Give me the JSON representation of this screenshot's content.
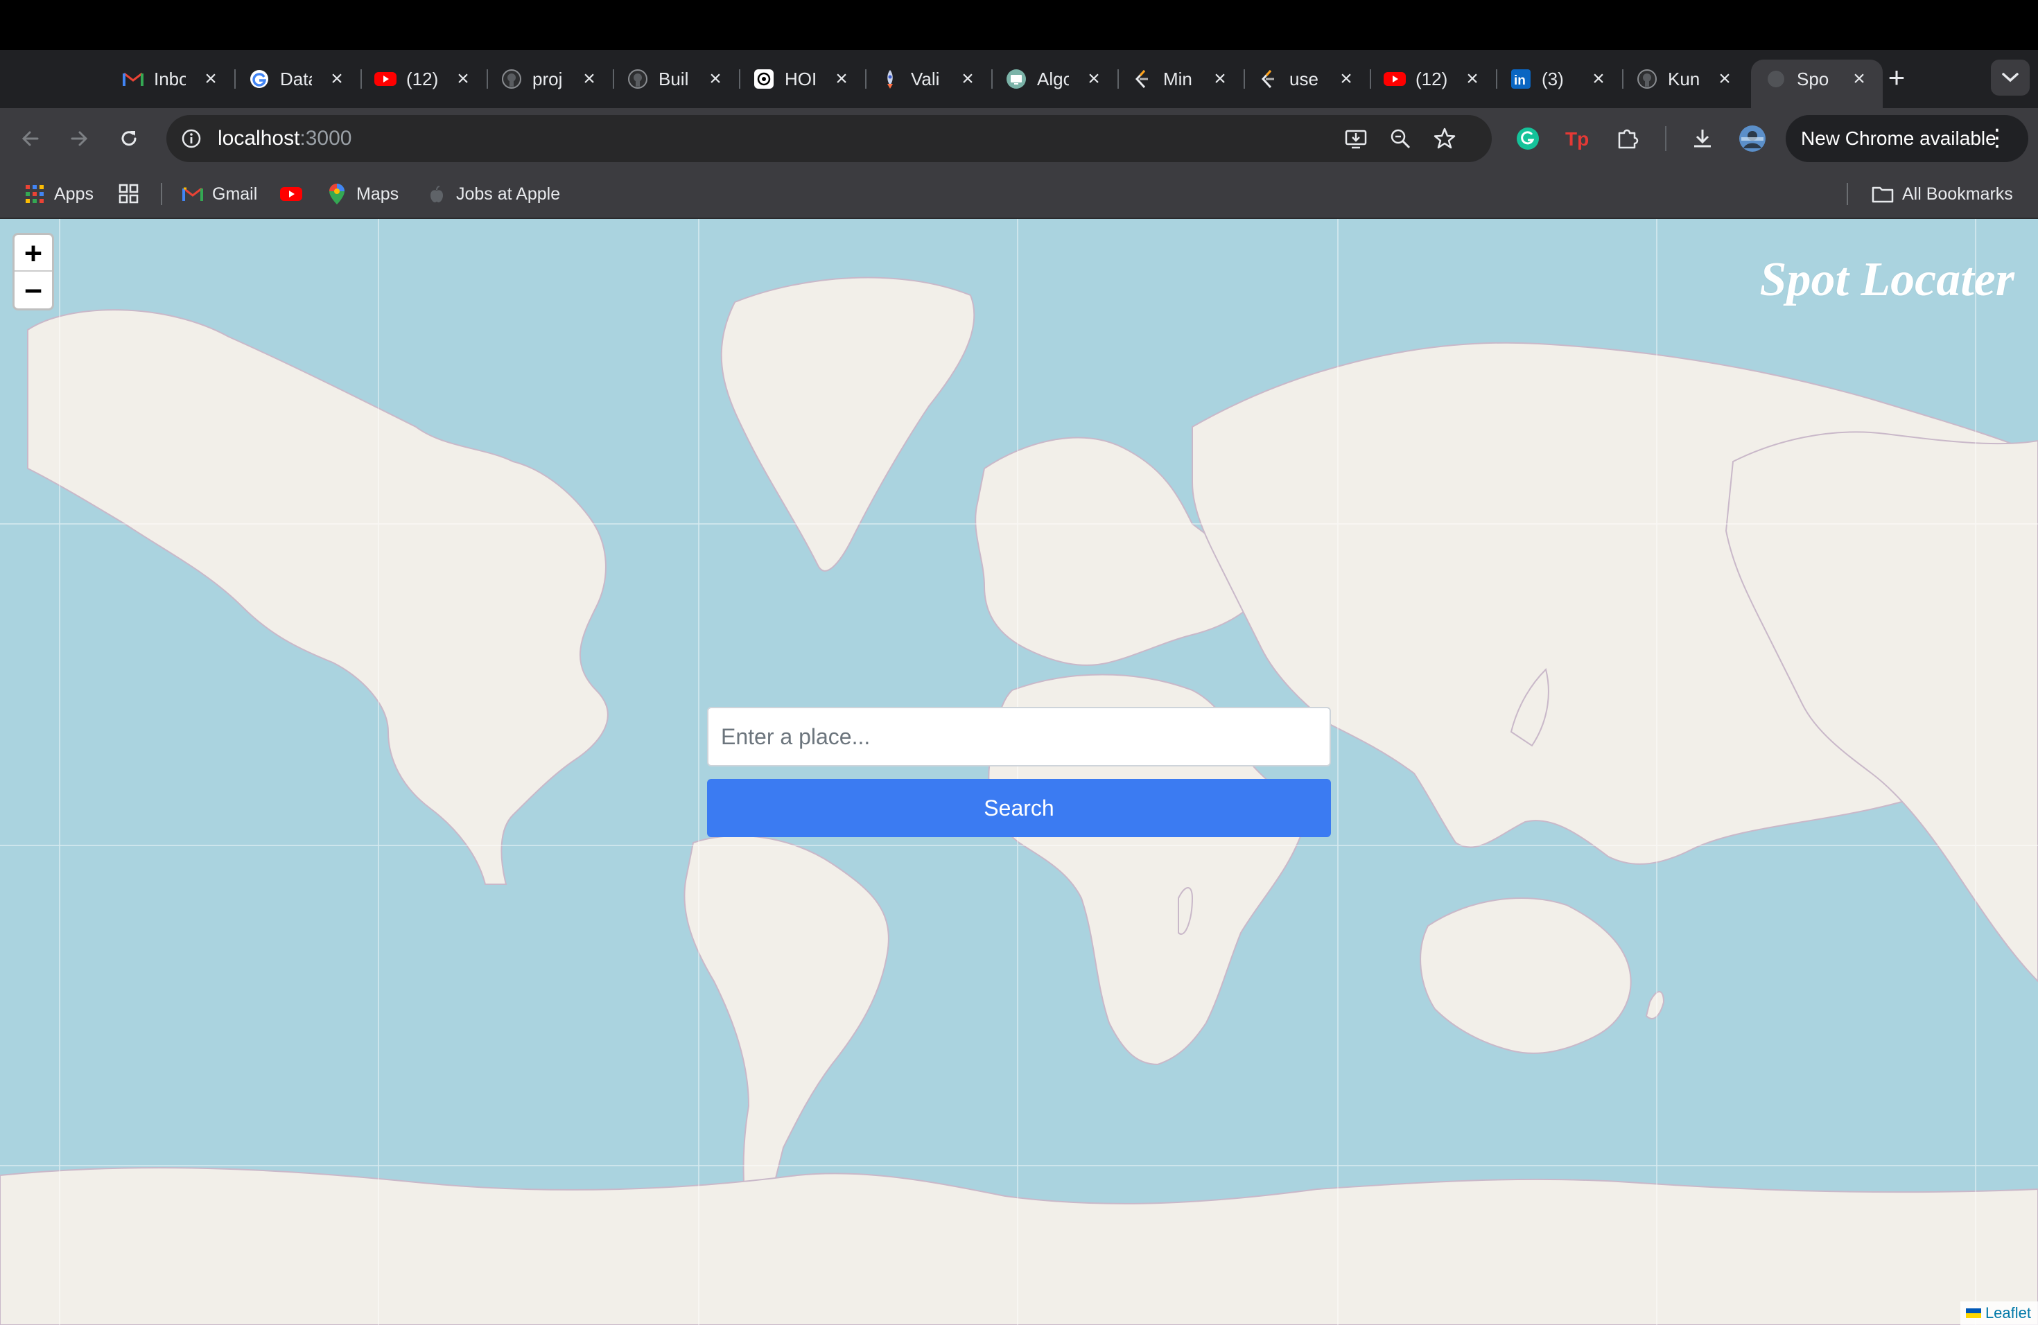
{
  "browser": {
    "tabs": [
      {
        "title": "Inbox",
        "icon": "gmail-icon",
        "active": false
      },
      {
        "title": "Data",
        "icon": "google-icon",
        "active": false
      },
      {
        "title": "(12)",
        "icon": "youtube-icon",
        "active": false
      },
      {
        "title": "proj",
        "icon": "github-icon",
        "active": false
      },
      {
        "title": "Buil",
        "icon": "github-icon",
        "active": false
      },
      {
        "title": "HOI",
        "icon": "openai-icon",
        "active": false
      },
      {
        "title": "Vali",
        "icon": "rocket-icon",
        "active": false
      },
      {
        "title": "Algo",
        "icon": "monitor-icon",
        "active": false
      },
      {
        "title": "Min",
        "icon": "leetcode-icon",
        "active": false
      },
      {
        "title": "use",
        "icon": "leetcode-icon",
        "active": false
      },
      {
        "title": "(12)",
        "icon": "youtube-icon",
        "active": false
      },
      {
        "title": "(3)",
        "icon": "linkedin-icon",
        "active": false
      },
      {
        "title": "Kun",
        "icon": "github-icon",
        "active": false
      },
      {
        "title": "Spo",
        "icon": "globe-icon",
        "active": true
      }
    ],
    "address": {
      "host": "localhost",
      "port": ":3000"
    },
    "update_label": "New Chrome available",
    "bookmarks": [
      {
        "label": "Apps",
        "icon": "apps-grid-icon"
      },
      {
        "label": "",
        "icon": "tab-groups-icon"
      },
      {
        "label": "Gmail",
        "icon": "gmail-icon"
      },
      {
        "label": "",
        "icon": "youtube-icon"
      },
      {
        "label": "Maps",
        "icon": "maps-pin-icon"
      },
      {
        "label": "Jobs at Apple",
        "icon": "apple-icon"
      }
    ],
    "all_bookmarks_label": "All Bookmarks"
  },
  "app": {
    "brand": "Spot Locater",
    "search": {
      "placeholder": "Enter a place...",
      "value": "",
      "button_label": "Search"
    },
    "zoom": {
      "in_label": "+",
      "out_label": "−"
    },
    "attribution": "Leaflet"
  },
  "colors": {
    "ocean": "#aad3df",
    "land": "#f2efe9",
    "search_button": "#3b7bf2",
    "chrome_dark": "#202124",
    "chrome_toolbar": "#3c3c40"
  }
}
